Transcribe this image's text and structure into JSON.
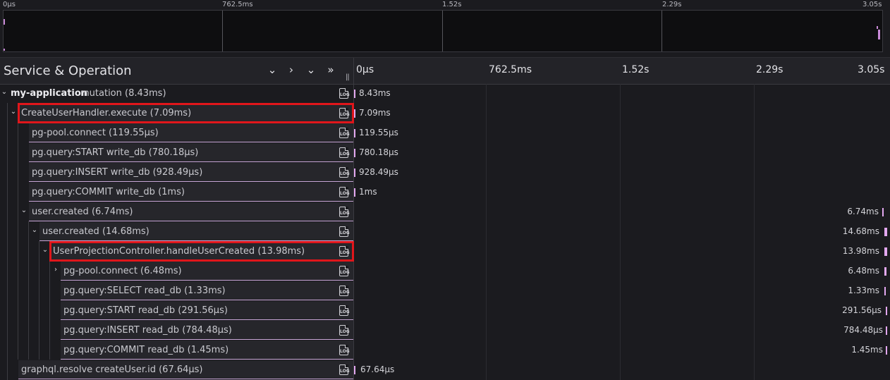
{
  "minimap": {
    "ticks": [
      "0µs",
      "762.5ms",
      "1.52s",
      "2.29s",
      "3.05s"
    ]
  },
  "header": {
    "title": "Service & Operation",
    "collapse_one_icon": "chevron-down-icon",
    "expand_one_icon": "chevron-right-icon",
    "collapse_all_icon": "double-chevron-down-icon",
    "expand_all_icon": "double-chevron-right-icon",
    "resizer": "||",
    "ticks": [
      "0µs",
      "762.5ms",
      "1.52s",
      "2.29s",
      "3.05s"
    ]
  },
  "colors": {
    "bar": "#e3a8f0",
    "highlight": "#e0161b",
    "row_underline": "#c9a7d8"
  },
  "rows": [
    {
      "service": "my-application",
      "operation": "mutation (8.43ms)",
      "duration": "8.43ms",
      "chevron": "⌄",
      "log": "LOG"
    },
    {
      "service": "",
      "operation": "CreateUserHandler.execute (7.09ms)",
      "duration": "7.09ms",
      "chevron": "⌄",
      "log": "LOG"
    },
    {
      "service": "",
      "operation": "pg-pool.connect (119.55µs)",
      "duration": "119.55µs",
      "chevron": "",
      "log": "LOG"
    },
    {
      "service": "",
      "operation": "pg.query:START write_db (780.18µs)",
      "duration": "780.18µs",
      "chevron": "",
      "log": "LOG"
    },
    {
      "service": "",
      "operation": "pg.query:INSERT write_db (928.49µs)",
      "duration": "928.49µs",
      "chevron": "",
      "log": "LOG"
    },
    {
      "service": "",
      "operation": "pg.query:COMMIT write_db (1ms)",
      "duration": "1ms",
      "chevron": "",
      "log": "LOG"
    },
    {
      "service": "",
      "operation": "user.created (6.74ms)",
      "duration": "6.74ms",
      "chevron": "⌄",
      "log": "LOG"
    },
    {
      "service": "",
      "operation": "user.created (14.68ms)",
      "duration": "14.68ms",
      "chevron": "⌄",
      "log": "LOG"
    },
    {
      "service": "",
      "operation": "UserProjectionController.handleUserCreated (13.98ms)",
      "duration": "13.98ms",
      "chevron": "⌄",
      "log": "LOG"
    },
    {
      "service": "",
      "operation": "pg-pool.connect (6.48ms)",
      "duration": "6.48ms",
      "chevron": "›",
      "log": "LOG"
    },
    {
      "service": "",
      "operation": "pg.query:SELECT read_db (1.33ms)",
      "duration": "1.33ms",
      "chevron": "",
      "log": "LOG"
    },
    {
      "service": "",
      "operation": "pg.query:START read_db (291.56µs)",
      "duration": "291.56µs",
      "chevron": "",
      "log": "LOG"
    },
    {
      "service": "",
      "operation": "pg.query:INSERT read_db (784.48µs)",
      "duration": "784.48µs",
      "chevron": "",
      "log": "LOG"
    },
    {
      "service": "",
      "operation": "pg.query:COMMIT read_db (1.45ms)",
      "duration": "1.45ms",
      "chevron": "",
      "log": "LOG"
    },
    {
      "service": "",
      "operation": "graphql.resolve createUser.id (67.64µs)",
      "duration": "67.64µs",
      "chevron": "",
      "log": "LOG"
    }
  ]
}
